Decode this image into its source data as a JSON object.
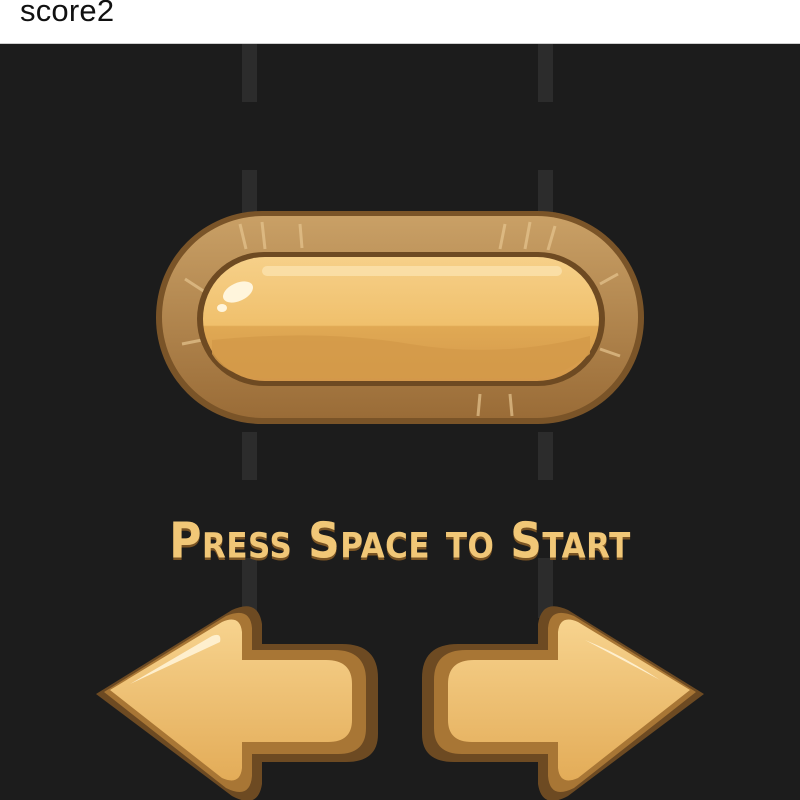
{
  "hud": {
    "score_label": "score",
    "score_value": "2"
  },
  "start_screen": {
    "prompt": "Press Space to Start",
    "start_key_icon": "spacebar-key-icon",
    "left_icon": "left-arrow-icon",
    "right_icon": "right-arrow-icon"
  },
  "colors": {
    "background": "#1c1c1c",
    "lane_marker": "#2c2c2c",
    "gold_light": "#f3c978",
    "gold_dark": "#8a5f2a",
    "text_gold": "#f1c777"
  }
}
